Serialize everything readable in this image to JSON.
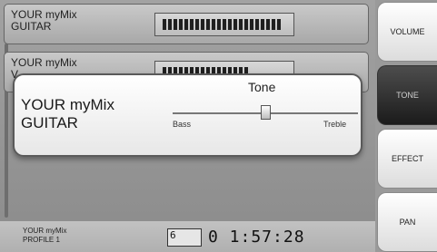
{
  "channels": [
    {
      "name": "YOUR myMix\nGUITAR",
      "level": 0.92
    },
    {
      "name": "YOUR myMix\nV",
      "level": 0.65
    }
  ],
  "popup": {
    "name": "YOUR myMix\nGUITAR",
    "title": "Tone",
    "left_label": "Bass",
    "right_label": "Treble",
    "value": 0.5
  },
  "sidebar": {
    "buttons": [
      {
        "label": "VOLUME",
        "active": false
      },
      {
        "label": "TONE",
        "active": true
      },
      {
        "label": "EFFECT",
        "active": false
      },
      {
        "label": "PAN",
        "active": false
      }
    ]
  },
  "footer": {
    "profile": "YOUR myMix\nPROFILE 1",
    "counter": "6",
    "time": "0 1:57:28"
  }
}
